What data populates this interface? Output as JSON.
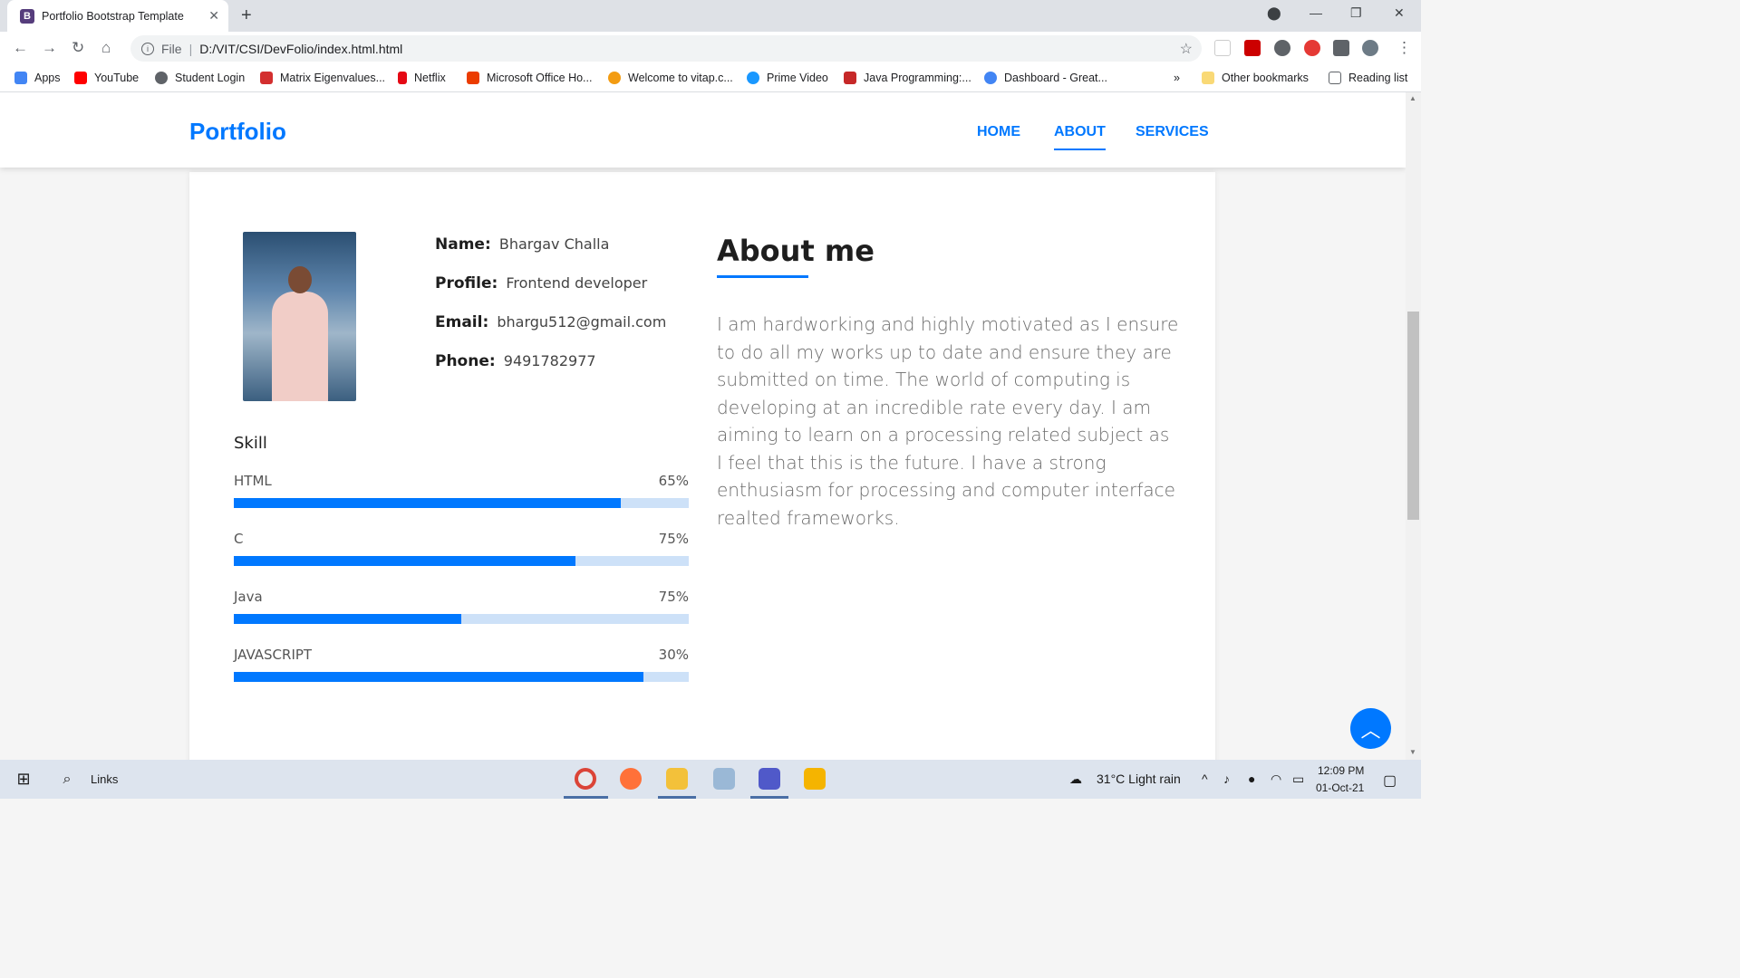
{
  "browser": {
    "tab_title": "Portfolio Bootstrap Template",
    "tab_favicon_letter": "B",
    "address_protocol": "File",
    "address_url": "D:/VIT/CSI/DevFolio/index.html.html",
    "bookmarks": [
      {
        "label": "Apps",
        "color": "#4285f4"
      },
      {
        "label": "YouTube",
        "color": "#ff0000"
      },
      {
        "label": "Student Login",
        "color": "#5f6368"
      },
      {
        "label": "Matrix Eigenvalues...",
        "color": "#d32f2f"
      },
      {
        "label": "Netflix",
        "color": "#e50914"
      },
      {
        "label": "Microsoft Office Ho...",
        "color": "#eb3c00"
      },
      {
        "label": "Welcome to vitap.c...",
        "color": "#f39c12"
      },
      {
        "label": "Prime Video",
        "color": "#1a98ff"
      },
      {
        "label": "Java Programming:...",
        "color": "#c62828"
      },
      {
        "label": "Dashboard - Great...",
        "color": "#4285f4"
      }
    ],
    "other_bookmarks": "Other bookmarks",
    "reading_list": "Reading list",
    "overflow": "»"
  },
  "site": {
    "brand": "Portfolio",
    "nav": [
      {
        "label": "HOME",
        "active": false
      },
      {
        "label": "ABOUT",
        "active": true
      },
      {
        "label": "SERVICES",
        "active": false
      }
    ],
    "accent_color": "#0078ff"
  },
  "profile": {
    "name_label": "Name:",
    "name_value": "Bhargav Challa",
    "profile_label": "Profile:",
    "profile_value": "Frontend developer",
    "email_label": "Email:",
    "email_value": "bhargu512@gmail.com",
    "phone_label": "Phone:",
    "phone_value": "9491782977"
  },
  "skills": {
    "title": "Skill",
    "items": [
      {
        "name": "HTML",
        "percent_label": "65%",
        "fill": 0.85
      },
      {
        "name": "C",
        "percent_label": "75%",
        "fill": 0.75
      },
      {
        "name": "Java",
        "percent_label": "75%",
        "fill": 0.5
      },
      {
        "name": "JAVASCRIPT",
        "percent_label": "30%",
        "fill": 0.9
      }
    ]
  },
  "about": {
    "title": "About me",
    "text": "I am hardworking and highly motivated as I ensure to do all my works up to date and ensure they are submitted on time. The world of computing is developing at an incredible rate every day. I am aiming to learn on a processing related subject as I feel that this is the future. I have a strong enthusiasm for processing and computer interface realted frameworks."
  },
  "taskbar": {
    "search_label": "Links",
    "weather": "31°C  Light rain",
    "time": "12:09 PM",
    "date": "01-Oct-21"
  }
}
